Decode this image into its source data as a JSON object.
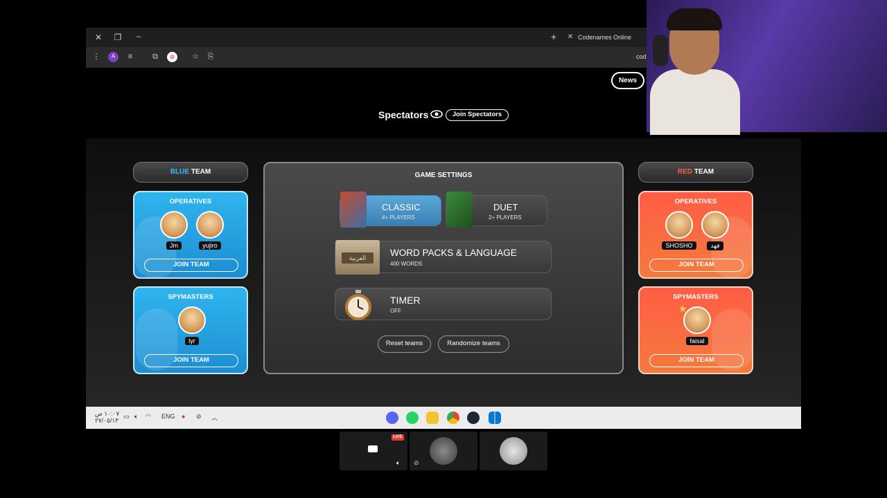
{
  "browser": {
    "tab_title": "Codenames Online",
    "address_fragment": "cod",
    "profile_initial": "A"
  },
  "header": {
    "news_label": "News",
    "spectators_label": "Spectators",
    "join_spectators_label": "Join Spectators"
  },
  "blue_team": {
    "title_prefix": "BLUE",
    "title_suffix": " TEAM",
    "operatives_title": "OPERATIVES",
    "operatives": [
      "Jm",
      "yujiro"
    ],
    "spymasters_title": "SPYMASTERS",
    "spymasters": [
      "lyr"
    ],
    "join_label": "JOIN TEAM"
  },
  "red_team": {
    "title_prefix": "RED",
    "title_suffix": " TEAM",
    "operatives_title": "OPERATIVES",
    "operatives": [
      "SHOSHO",
      "فهد"
    ],
    "spymasters_title": "SPYMASTERS",
    "spymasters": [
      "faisal"
    ],
    "join_label": "JOIN TEAM"
  },
  "settings": {
    "title": "GAME SETTINGS",
    "classic": {
      "label": "CLASSIC",
      "sub": "4+ PLAYERS",
      "selected": true
    },
    "duet": {
      "label": "DUET",
      "sub": "2+ PLAYERS",
      "selected": false
    },
    "word_packs": {
      "label": "WORD PACKS & LANGUAGE",
      "sub": "400 WORDS",
      "box_text": "العربية"
    },
    "timer": {
      "label": "TIMER",
      "sub": "OFF"
    },
    "reset_label": "Reset teams",
    "randomize_label": "Randomize teams"
  },
  "taskbar": {
    "time": "١٠:٠٧ ص",
    "date": "٢٧/٠٥/١٣",
    "lang": "ENG"
  },
  "participants": {
    "live_badge": "LIVE"
  },
  "colors": {
    "blue_accent": "#39b7ff",
    "red_accent": "#ff5b4a",
    "classic_selected": "#4a93c8"
  }
}
